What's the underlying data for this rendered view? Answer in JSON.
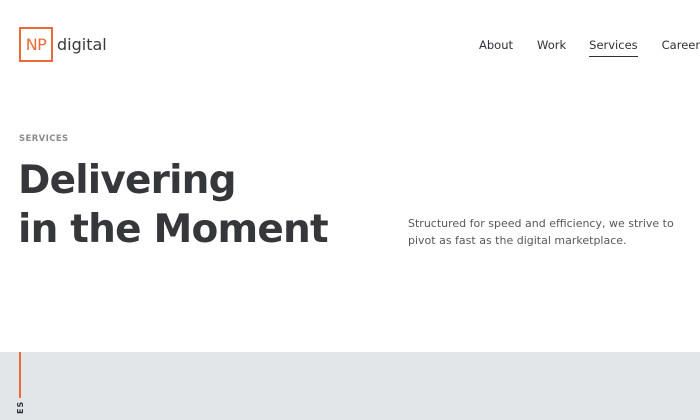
{
  "header": {
    "logo_mark": "NP",
    "logo_word": "digital",
    "nav": [
      {
        "label": "About",
        "active": false
      },
      {
        "label": "Work",
        "active": false
      },
      {
        "label": "Services",
        "active": true
      },
      {
        "label": "Careers",
        "active": false
      }
    ]
  },
  "hero": {
    "eyebrow": "SERVICES",
    "headline_line1": "Delivering",
    "headline_line2": "in the Moment",
    "description": "Structured for speed and efficiency, we strive to pivot as fast as the digital marketplace."
  },
  "band": {
    "vertical_label": "ES"
  },
  "colors": {
    "accent": "#ec6a38",
    "text_dark": "#35373b",
    "band_bg": "#e3e6e9"
  }
}
